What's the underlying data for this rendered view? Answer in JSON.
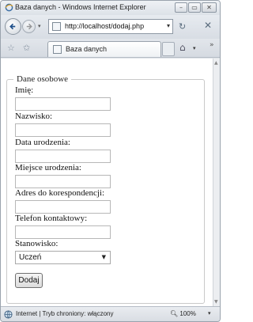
{
  "window": {
    "title": "Baza danych - Windows Internet Explorer",
    "minimize_glyph": "–",
    "maximize_glyph": "▭",
    "close_glyph": "✕"
  },
  "address_bar": {
    "url": "http://localhost/dodaj.php",
    "drop_glyph": "▾",
    "refresh_glyph": "↻",
    "stop_glyph": "✕"
  },
  "tab": {
    "label": "Baza danych"
  },
  "form": {
    "legend": "Dane osobowe",
    "fields": [
      {
        "label": "Imię:",
        "value": ""
      },
      {
        "label": "Nazwisko:",
        "value": ""
      },
      {
        "label": "Data urodzenia:",
        "value": ""
      },
      {
        "label": "Miejsce urodzenia:",
        "value": ""
      },
      {
        "label": "Adres do korespondencji:",
        "value": ""
      },
      {
        "label": "Telefon kontaktowy:",
        "value": ""
      }
    ],
    "position_label": "Stanowisko:",
    "position_selected": "Uczeń",
    "submit_label": "Dodaj"
  },
  "status_bar": {
    "text": "Internet | Tryb chroniony: włączony",
    "zoom": "100%"
  },
  "icons": {
    "back": "back-arrow-icon",
    "forward": "forward-arrow-icon",
    "favorites": "star-icon",
    "home": "home-icon",
    "globe": "globe-icon"
  }
}
